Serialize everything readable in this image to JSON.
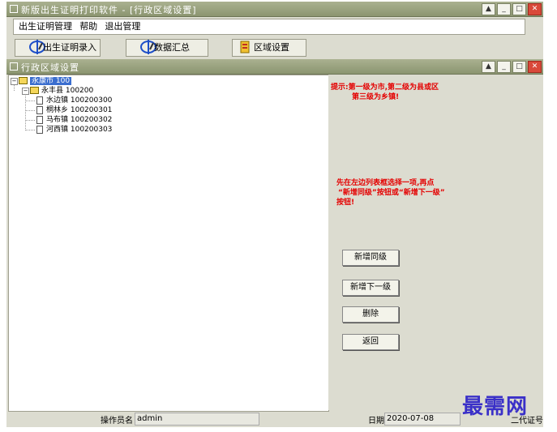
{
  "window": {
    "title": "新版出生证明打印软件    - [行政区域设置]"
  },
  "menu": [
    "出生证明管理",
    "帮助",
    "退出管理"
  ],
  "toolbar": {
    "birth_entry": "出生证明录入",
    "data_summary": "数据汇总",
    "region_settings": "区域设置"
  },
  "subwindow": {
    "title": "行政区域设置"
  },
  "tree": {
    "root": "永康市 100",
    "county": "永丰县 100200",
    "towns": [
      "水边镇 100200300",
      "桐林乡 100200301",
      "马布镇 100200302",
      "河西镇 100200303"
    ]
  },
  "hints": {
    "line1": "提示:第一级为市,第二级为县或区",
    "line2": "第三级为乡镇!",
    "line3": "先在左边列表框选择一项,再点",
    "line4": "“新增同级”按钮或“新增下一级”",
    "line5": "按钮!"
  },
  "actions": {
    "add_sibling": "新增同级",
    "add_child": "新增下一级",
    "delete": "删除",
    "back": "返回"
  },
  "status": {
    "operator_label": "操作员名",
    "operator": "admin",
    "date_label": "日期",
    "date": "2020-07-08",
    "right_text": "二代证号"
  },
  "watermark": "最需网"
}
